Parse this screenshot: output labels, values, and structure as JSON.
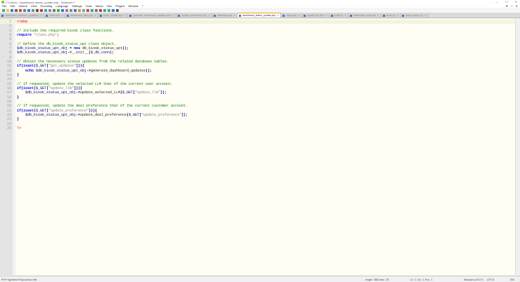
{
  "window": {
    "title": "C:\\Users\\...\\dashboard_status_update.php - Notepad++",
    "controls": [
      "—",
      "☐",
      "✕"
    ]
  },
  "menu": [
    "File",
    "Edit",
    "Search",
    "View",
    "Encoding",
    "Language",
    "Settings",
    "Tools",
    "Macro",
    "Run",
    "Plugins",
    "Window",
    "?"
  ],
  "menu_right": [
    "▼",
    "+",
    "✕"
  ],
  "tabs": [
    {
      "label": "dashboard_interface_update.js",
      "active": false
    },
    {
      "label": "index.php",
      "active": false
    },
    {
      "label": "dashboard_tabs.php",
      "active": false
    },
    {
      "label": "kiosk_update.php",
      "active": false
    },
    {
      "label": "generate_dashboard_updates.php",
      "active": false
    },
    {
      "label": "update_preference.php",
      "active": false
    },
    {
      "label": "database.php",
      "active": false
    },
    {
      "label": "dashboard_status_update.php",
      "active": true
    },
    {
      "label": "class.php",
      "active": false
    },
    {
      "label": "update_llm.php",
      "active": false
    },
    {
      "label": "index.js",
      "active": false
    },
    {
      "label": "dashboard_style.css",
      "active": false
    },
    {
      "label": "kiosk.py",
      "active": false
    },
    {
      "label": "serial_comm.py",
      "active": false
    }
  ],
  "code": [
    "<?php",
    "",
    "// Include the required kiosk class functions.",
    "require \"class.php\";",
    "",
    "// Define the db_kiosk_status_upt class object.",
    "$db_kiosk_status_upt_obj = new db_kiosk_status_upt();",
    "$db_kiosk_status_upt_obj->__init__($_db_conn);",
    "",
    "// Obtain the necessary status updates from the related database tables.",
    "if(isset($_GET[\"get_updates\"])){",
    "    echo $db_kiosk_status_upt_obj->generate_dashboard_updates();",
    "}",
    "",
    "// If requested, update the selected LLM that of the current user account.",
    "if(isset($_GET[\"update_llm\"])){",
    "    $db_kiosk_status_upt_obj->update_selected_LLM($_GET[\"update_llm\"]);",
    "}",
    "",
    "// If requested, update the deal preference that of the current customer account.",
    "if(isset($_GET[\"update_preference\"])){",
    "    $db_kiosk_status_upt_obj->update_deal_preference($_GET[\"update_preference\"]);",
    "}",
    "",
    "?>"
  ],
  "status": {
    "file_type": "PHP Hypertext Preprocessor file",
    "length": "length : 888    lines : 25",
    "position": "Ln : 1    Col : 1    Pos : 1",
    "eol": "Windows (CR LF)",
    "encoding": "UTF-8",
    "mode": "INS"
  }
}
